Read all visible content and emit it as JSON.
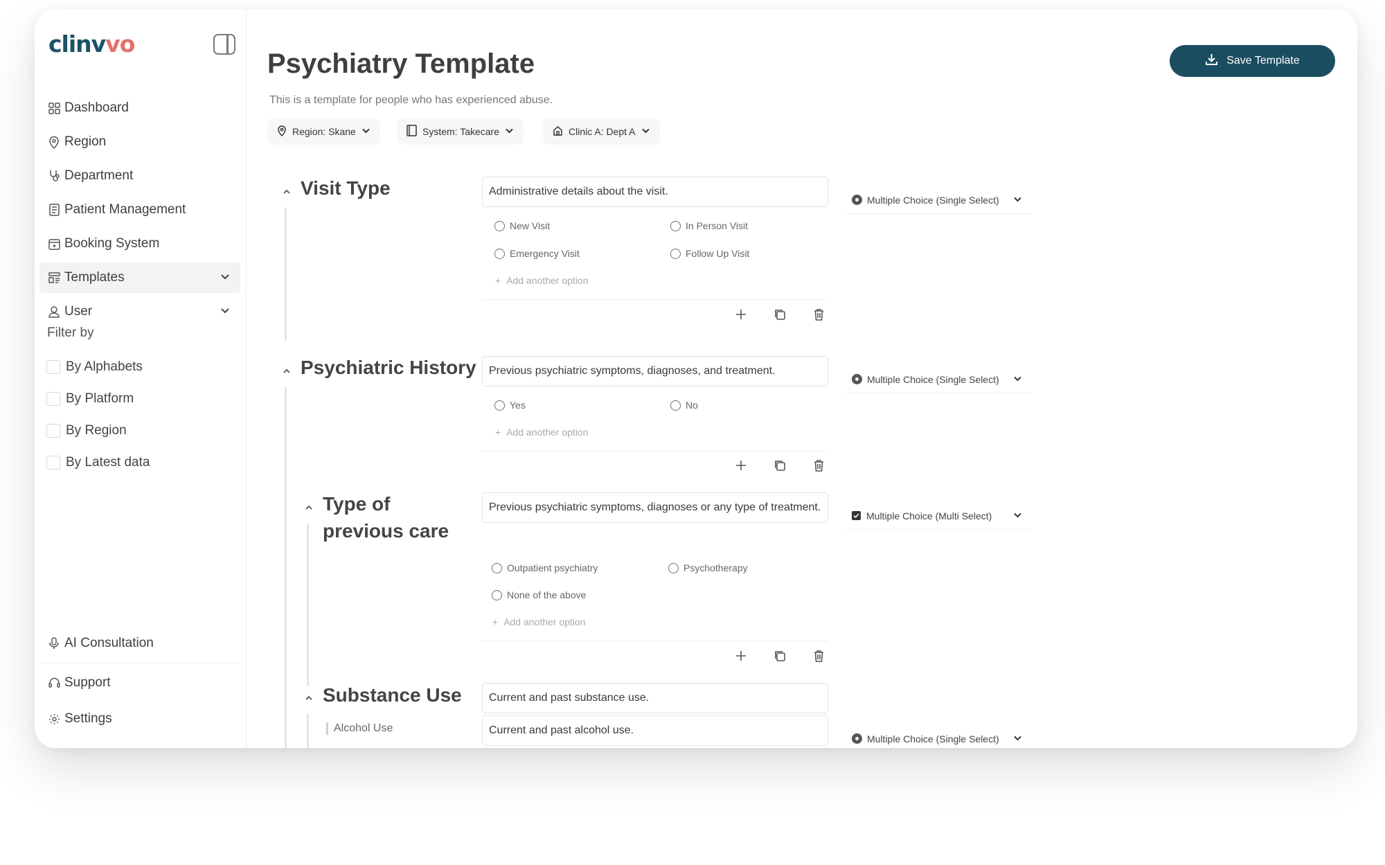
{
  "app": {
    "logo_a": "clinv",
    "logo_b": "vo"
  },
  "sidebar": {
    "items": [
      {
        "label": "Dashboard",
        "icon": "dashboard-icon"
      },
      {
        "label": "Region",
        "icon": "location-pin-icon"
      },
      {
        "label": "Department",
        "icon": "stethoscope-icon"
      },
      {
        "label": "Patient Management",
        "icon": "document-icon"
      },
      {
        "label": "Booking System",
        "icon": "calendar-icon"
      },
      {
        "label": "Templates",
        "icon": "template-icon",
        "active": true
      },
      {
        "label": "User",
        "icon": "user-icon"
      }
    ],
    "filter_title": "Filter by",
    "filters": [
      "By Alphabets",
      "By Platform",
      "By Region",
      "By Latest data"
    ],
    "bottom": [
      {
        "label": "AI Consultation",
        "icon": "microphone-icon"
      },
      {
        "label": "Support",
        "icon": "headset-icon"
      },
      {
        "label": "Settings",
        "icon": "gear-icon"
      }
    ]
  },
  "header": {
    "title": "Psychiatry Template",
    "subtitle": "This is a template for people who has experienced abuse.",
    "save_label": "Save Template",
    "chips": [
      "Region: Skane",
      "System: Takecare",
      "Clinic A: Dept A"
    ]
  },
  "sections": [
    {
      "title": "Visit Type",
      "question": "Administrative details about the visit.",
      "type": "Multiple Choice (Single Select)",
      "options": [
        "New Visit",
        "In Person Visit",
        "Emergency Visit",
        "Follow Up Visit"
      ],
      "add_option": "Add another option"
    },
    {
      "title": "Psychiatric History",
      "question": "Previous psychiatric symptoms, diagnoses, and treatment.",
      "type": "Multiple Choice (Single Select)",
      "options": [
        "Yes",
        "No"
      ],
      "add_option": "Add another option"
    },
    {
      "title": "Type of previous care",
      "question": "Previous psychiatric symptoms, diagnoses or any type of treatment.",
      "type": "Multiple Choice (Multi Select)",
      "options": [
        "Outpatient psychiatry",
        "Psychotherapy",
        "None of the above"
      ],
      "add_option": "Add another option"
    },
    {
      "title": "Substance Use",
      "question": "Current and past substance use.",
      "sub_label": "Alcohol Use",
      "sub_question": "Current and past alcohol use.",
      "sub_type": "Multiple Choice (Single Select)"
    }
  ],
  "colors": {
    "primary": "#1b4d60",
    "accent": "#e2726a"
  }
}
